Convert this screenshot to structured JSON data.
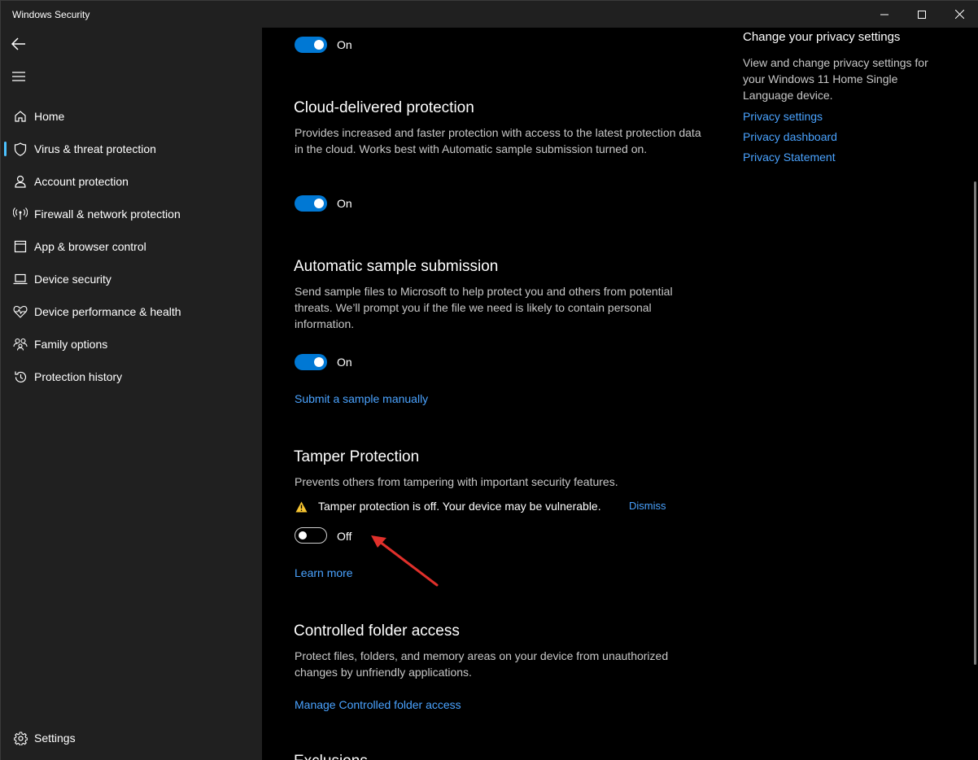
{
  "window": {
    "title": "Windows Security"
  },
  "sidebar": {
    "back_icon": "arrow-left-icon",
    "menu_icon": "hamburger-icon",
    "items": [
      {
        "label": "Home",
        "icon": "home-icon"
      },
      {
        "label": "Virus & threat protection",
        "icon": "shield-icon",
        "active": true
      },
      {
        "label": "Account protection",
        "icon": "person-icon"
      },
      {
        "label": "Firewall & network protection",
        "icon": "wifi-antenna-icon"
      },
      {
        "label": "App & browser control",
        "icon": "browser-window-icon"
      },
      {
        "label": "Device security",
        "icon": "laptop-icon"
      },
      {
        "label": "Device performance & health",
        "icon": "heart-pulse-icon"
      },
      {
        "label": "Family options",
        "icon": "family-icon"
      },
      {
        "label": "Protection history",
        "icon": "history-icon"
      }
    ],
    "settings": {
      "label": "Settings",
      "icon": "gear-icon"
    }
  },
  "main": {
    "top_toggle": {
      "state": "On"
    },
    "cloud": {
      "title": "Cloud-delivered protection",
      "description": "Provides increased and faster protection with access to the latest protection data in the cloud. Works best with Automatic sample submission turned on.",
      "toggle": "On"
    },
    "sample": {
      "title": "Automatic sample submission",
      "description": "Send sample files to Microsoft to help protect you and others from potential threats. We’ll prompt you if the file we need is likely to contain personal information.",
      "toggle": "On",
      "link": "Submit a sample manually"
    },
    "tamper": {
      "title": "Tamper Protection",
      "description": "Prevents others from tampering with important security features.",
      "warning": "Tamper protection is off. Your device may be vulnerable.",
      "dismiss": "Dismiss",
      "toggle": "Off",
      "link": "Learn more"
    },
    "cfa": {
      "title": "Controlled folder access",
      "description": "Protect files, folders, and memory areas on your device from unauthorized changes by unfriendly applications.",
      "link": "Manage Controlled folder access"
    },
    "next_title_partial": "Exclusions"
  },
  "privacy": {
    "title": "Change your privacy settings",
    "description": "View and change privacy settings for your Windows 11 Home Single Language device.",
    "links": [
      "Privacy settings",
      "Privacy dashboard",
      "Privacy Statement"
    ]
  },
  "colors": {
    "accent": "#0078d4",
    "link": "#4aa3ff",
    "warning": "#f7c531",
    "annotation_arrow": "#e0302b"
  }
}
